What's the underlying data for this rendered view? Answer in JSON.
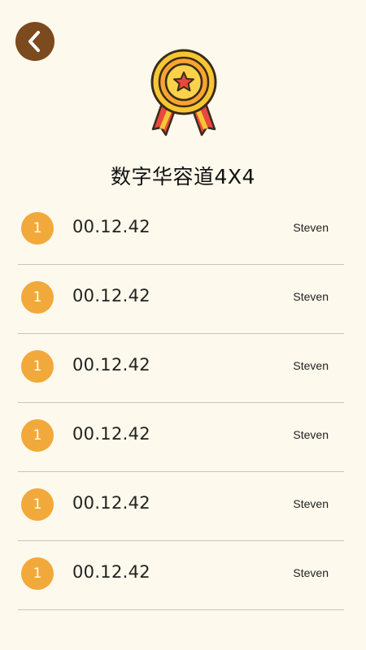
{
  "header": {
    "title": "数字华容道4X4"
  },
  "colors": {
    "background": "#FDF9EC",
    "back_button": "#7B4A1E",
    "rank_badge": "#F2A93B",
    "divider": "#C9C6B6"
  },
  "icons": {
    "back": "chevron-left-icon",
    "medal": "medal-icon"
  },
  "records": [
    {
      "rank": "1",
      "time": "00.12.42",
      "name": "Steven"
    },
    {
      "rank": "1",
      "time": "00.12.42",
      "name": "Steven"
    },
    {
      "rank": "1",
      "time": "00.12.42",
      "name": "Steven"
    },
    {
      "rank": "1",
      "time": "00.12.42",
      "name": "Steven"
    },
    {
      "rank": "1",
      "time": "00.12.42",
      "name": "Steven"
    },
    {
      "rank": "1",
      "time": "00.12.42",
      "name": "Steven"
    }
  ]
}
